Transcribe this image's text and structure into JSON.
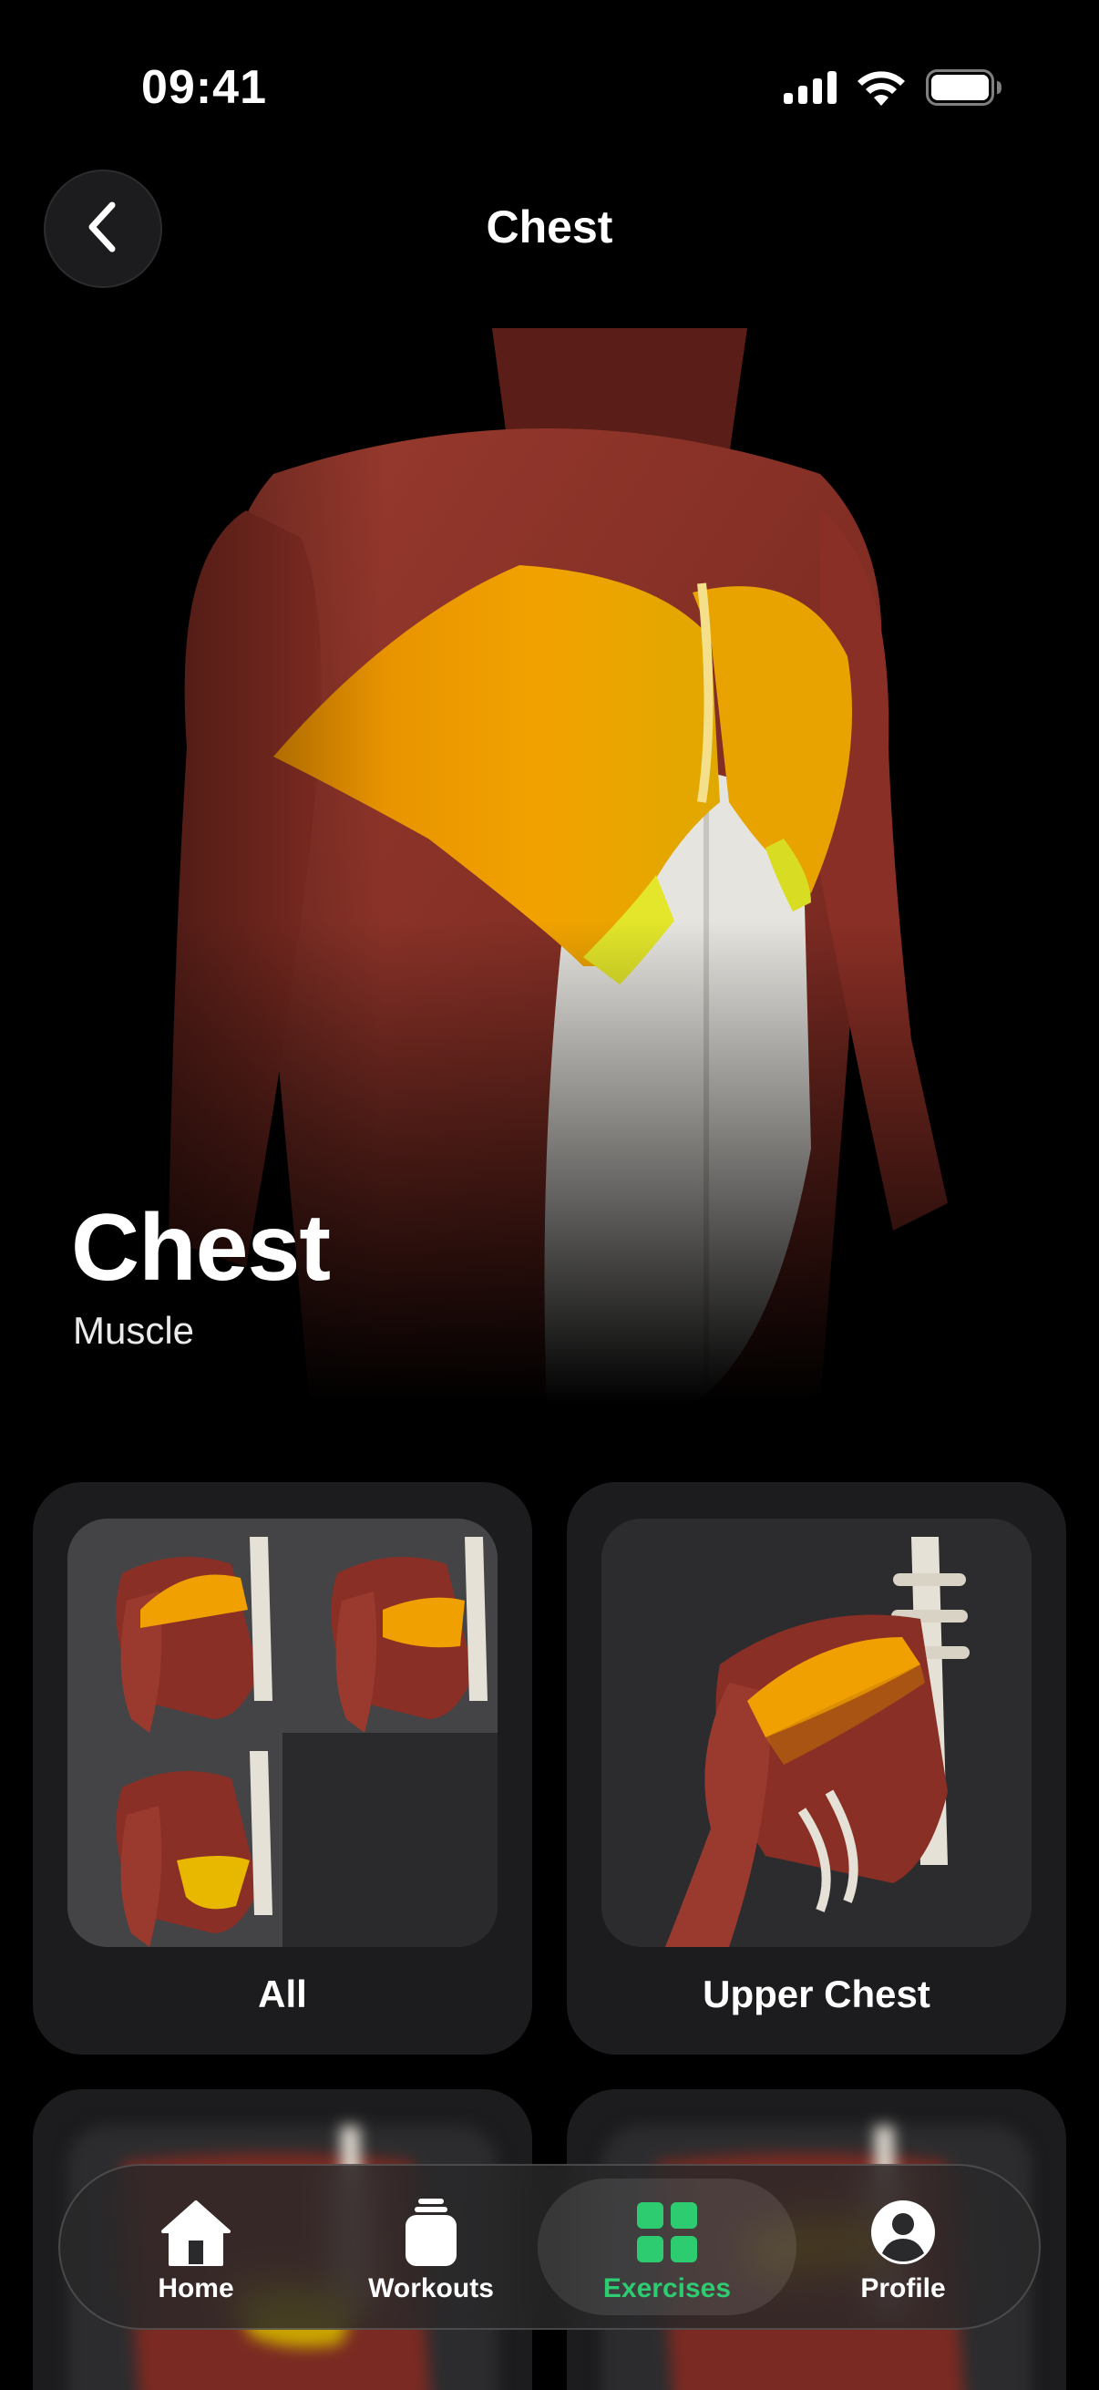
{
  "status_bar": {
    "time": "09:41",
    "icons": [
      "signal-icon",
      "wifi-icon",
      "battery-icon"
    ]
  },
  "header": {
    "back_icon": "chevron-left-icon",
    "title": "Chest"
  },
  "hero": {
    "title": "Chest",
    "subtitle": "Muscle",
    "highlight_color": "#f0a000"
  },
  "categories": [
    {
      "label": "All"
    },
    {
      "label": "Upper Chest"
    }
  ],
  "tab_bar": {
    "active_color": "#2ecc71",
    "items": [
      {
        "label": "Home",
        "icon": "home-icon",
        "active": false
      },
      {
        "label": "Workouts",
        "icon": "workouts-icon",
        "active": false
      },
      {
        "label": "Exercises",
        "icon": "exercises-grid-icon",
        "active": true
      },
      {
        "label": "Profile",
        "icon": "profile-icon",
        "active": false
      }
    ]
  }
}
